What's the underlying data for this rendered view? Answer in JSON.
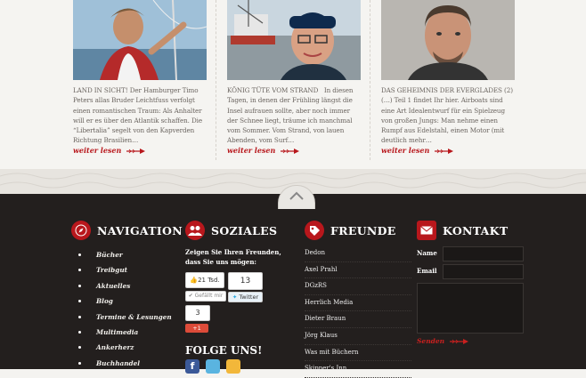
{
  "articles": [
    {
      "headline": "LAND IN SICHT!",
      "body": "Der Hamburger Timo Peters allas Bruder Leichtfuss verfolgt einen romantischen Traum: Als Anhalter will er es über den Atlantik schaffen. Die “Libertalia” segelt von den Kapverden Richtung Brasilien…",
      "more": "weiter lesen"
    },
    {
      "headline": "KÖNIG TÜTE VOM STRAND",
      "body": "In diesen Tagen, in denen der Frühling längst die Insel aufrauen sollte, aber noch immer der Schnee liegt, träume ich manchmal vom Sommer. Vom Strand, von lauen Abenden, vom Surf…",
      "more": "weiter lesen"
    },
    {
      "headline": "DAS GEHEIMNIS DER EVERGLADES (2)",
      "body": "(…) Teil 1 findet Ihr hier.   Airboats sind eine Art Idealentwurf für ein Spielzeug von großen Jungs: Man nehme einen Rumpf aus Edelstahl, einen Motor (mit deutlich mehr…",
      "more": "weiter lesen"
    }
  ],
  "nav": {
    "title": "NAVIGATION",
    "items": [
      "Bücher",
      "Treibgut",
      "Aktuelles",
      "Blog",
      "Termine & Lesungen",
      "Multimedia",
      "Ankerherz",
      "Buchhandel"
    ]
  },
  "social": {
    "title": "SOZIALES",
    "text": "Zeigen Sie Ihren Freunden, dass Sie uns mögen:",
    "fb_count": "21 Tsd.",
    "fb_like": "Gefällt mir",
    "tw_count": "13",
    "tw_label": "Twitter",
    "gp_count": "3",
    "gp_label": "+1",
    "follow": "FOLGE UNS!"
  },
  "friends": {
    "title": "FREUNDE",
    "items": [
      "Dedon",
      "Axel Prahl",
      "DGzRS",
      "Herrlich Media",
      "Dieter Braun",
      "Jörg Klaus",
      "Was mit Büchern",
      "Skipper's Inn"
    ]
  },
  "contact": {
    "title": "KONTAKT",
    "name_label": "Name",
    "email_label": "Email",
    "send": "Senden"
  },
  "colors": {
    "accent": "#b8171c",
    "footer": "#231f1e"
  }
}
